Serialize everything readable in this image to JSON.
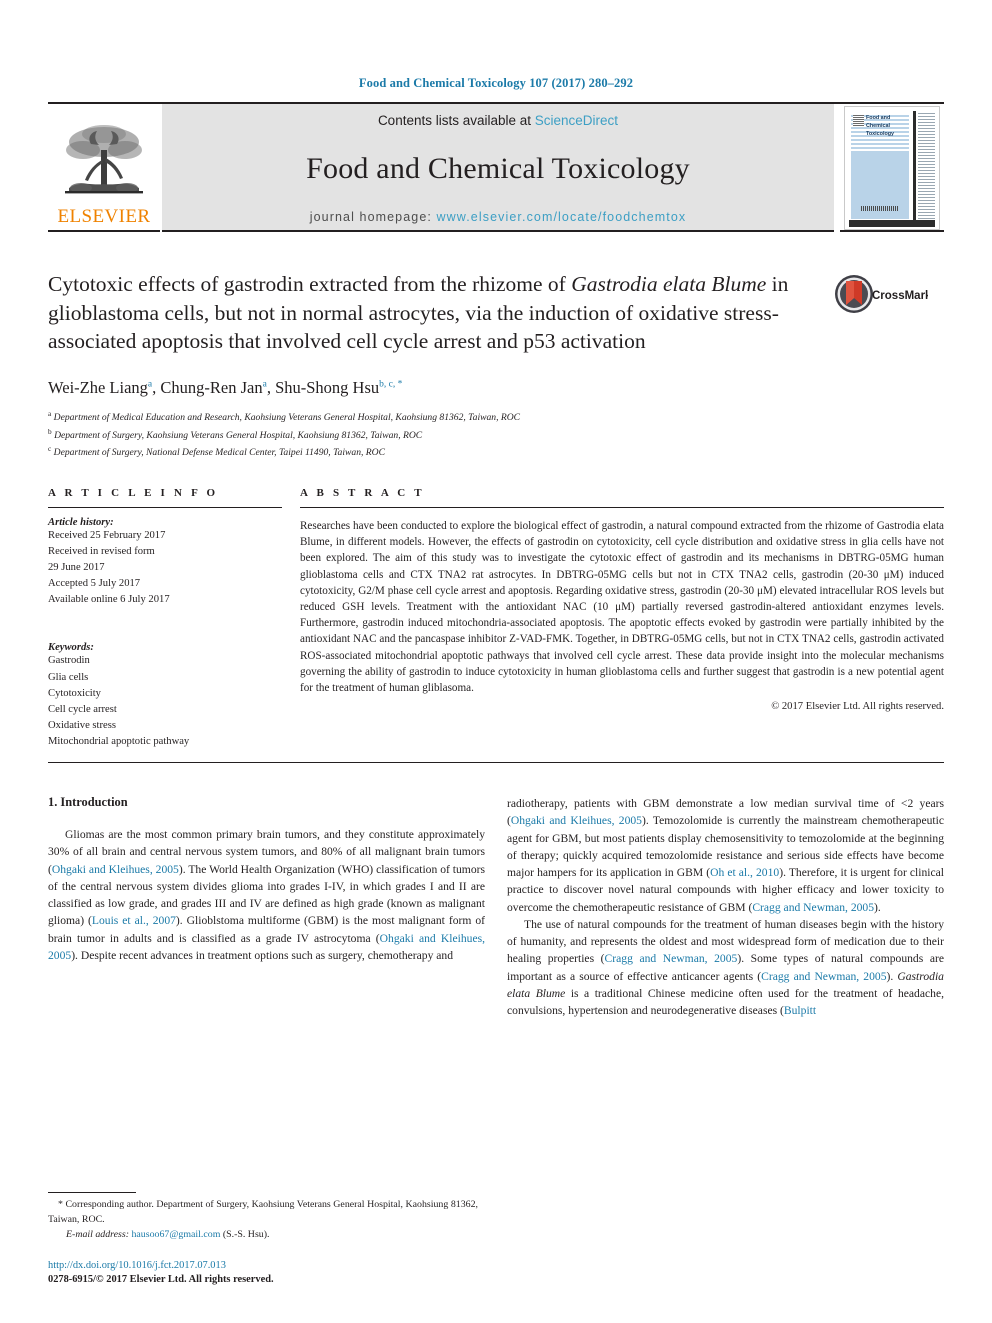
{
  "running_head": "Food and Chemical Toxicology 107 (2017) 280–292",
  "masthead": {
    "contents_prefix": "Contents lists available at ",
    "sciencedirect": "ScienceDirect",
    "journal_title": "Food and Chemical Toxicology",
    "homepage_label": "journal homepage: ",
    "homepage_url": "www.elsevier.com/locate/foodchemtox",
    "publisher": "ELSEVIER",
    "cover_title": "Food and Chemical Toxicology",
    "accent_link": "#3d9fc4",
    "accent_orange": "#ef8200",
    "cover_blue": "#b9d3e8"
  },
  "crossmark": {
    "label": "CrossMark"
  },
  "title": {
    "part1": "Cytotoxic effects of gastrodin extracted from the rhizome of ",
    "italic1": "Gastrodia elata Blume",
    "part2": " in glioblastoma cells, but not in normal astrocytes, via the induction of oxidative stress-associated apoptosis that involved cell cycle arrest and p53 activation"
  },
  "authors": [
    {
      "name": "Wei-Zhe Liang",
      "marks": "a"
    },
    {
      "name": "Chung-Ren Jan",
      "marks": "a"
    },
    {
      "name": "Shu-Shong Hsu",
      "marks": "b, c, *"
    }
  ],
  "authors_line": "Wei-Zhe Liang a, Chung-Ren Jan a, Shu-Shong Hsu b, c, *",
  "affiliations": [
    {
      "mark": "a",
      "text": "Department of Medical Education and Research, Kaohsiung Veterans General Hospital, Kaohsiung 81362, Taiwan, ROC"
    },
    {
      "mark": "b",
      "text": "Department of Surgery, Kaohsiung Veterans General Hospital, Kaohsiung 81362, Taiwan, ROC"
    },
    {
      "mark": "c",
      "text": "Department of Surgery, National Defense Medical Center, Taipei 11490, Taiwan, ROC"
    }
  ],
  "article_info": {
    "heading": "A R T I C L E   I N F O",
    "history_label": "Article history:",
    "history": [
      "Received 25 February 2017",
      "Received in revised form",
      "29 June 2017",
      "Accepted 5 July 2017",
      "Available online 6 July 2017"
    ],
    "keywords_label": "Keywords:",
    "keywords": [
      "Gastrodin",
      "Glia cells",
      "Cytotoxicity",
      "Cell cycle arrest",
      "Oxidative stress",
      "Mitochondrial apoptotic pathway"
    ]
  },
  "abstract": {
    "heading": "A B S T R A C T",
    "text": "Researches have been conducted to explore the biological effect of gastrodin, a natural compound extracted from the rhizome of Gastrodia elata Blume, in different models. However, the effects of gastrodin on cytotoxicity, cell cycle distribution and oxidative stress in glia cells have not been explored. The aim of this study was to investigate the cytotoxic effect of gastrodin and its mechanisms in DBTRG-05MG human glioblastoma cells and CTX TNA2 rat astrocytes. In DBTRG-05MG cells but not in CTX TNA2 cells, gastrodin (20-30 μM) induced cytotoxicity, G2/M phase cell cycle arrest and apoptosis. Regarding oxidative stress, gastrodin (20-30 μM) elevated intracellular ROS levels but reduced GSH levels. Treatment with the antioxidant NAC (10 μM) partially reversed gastrodin-altered antioxidant enzymes levels. Furthermore, gastrodin induced mitochondria-associated apoptosis. The apoptotic effects evoked by gastrodin were partially inhibited by the antioxidant NAC and the pancaspase inhibitor Z-VAD-FMK. Together, in DBTRG-05MG cells, but not in CTX TNA2 cells, gastrodin activated ROS-associated mitochondrial apoptotic pathways that involved cell cycle arrest. These data provide insight into the molecular mechanisms governing the ability of gastrodin to induce cytotoxicity in human glioblastoma cells and further suggest that gastrodin is a new potential agent for the treatment of human gliblasoma.",
    "copyright": "© 2017 Elsevier Ltd. All rights reserved."
  },
  "introduction": {
    "heading": "1. Introduction",
    "left_paragraphs": [
      {
        "segments": [
          {
            "t": "Gliomas are the most common primary brain tumors, and they constitute approximately 30% of all brain and central nervous system tumors, and 80% of all malignant brain tumors ("
          },
          {
            "t": "Ohgaki and Kleihues, 2005",
            "cite": true
          },
          {
            "t": "). The World Health Organization (WHO) classification of tumors of the central nervous system divides glioma into grades I-IV, in which grades I and II are classified as low grade, and grades III and IV are defined as high grade (known as malignant glioma) ("
          },
          {
            "t": "Louis et al., 2007",
            "cite": true
          },
          {
            "t": "). Glioblstoma multiforme (GBM) is the most malignant form of brain tumor in adults and is classified as a grade IV astrocytoma ("
          },
          {
            "t": "Ohgaki and Kleihues, 2005",
            "cite": true
          },
          {
            "t": "). Despite recent advances in treatment options such as surgery, chemotherapy and"
          }
        ]
      }
    ],
    "right_paragraphs": [
      {
        "indent": false,
        "segments": [
          {
            "t": "radiotherapy, patients with GBM demonstrate a low median survival time of <2 years ("
          },
          {
            "t": "Ohgaki and Kleihues, 2005",
            "cite": true
          },
          {
            "t": "). Temozolomide is currently the mainstream chemotherapeutic agent for GBM, but most patients display chemosensitivity to temozolomide at the beginning of therapy; quickly acquired temozolomide resistance and serious side effects have become major hampers for its application in GBM ("
          },
          {
            "t": "Oh et al., 2010",
            "cite": true
          },
          {
            "t": "). Therefore, it is urgent for clinical practice to discover novel natural compounds with higher efficacy and lower toxicity to overcome the chemotherapeutic resistance of GBM ("
          },
          {
            "t": "Cragg and Newman, 2005",
            "cite": true
          },
          {
            "t": ")."
          }
        ]
      },
      {
        "indent": true,
        "segments": [
          {
            "t": "The use of natural compounds for the treatment of human diseases begin with the history of humanity, and represents the oldest and most widespread form of medication due to their healing properties ("
          },
          {
            "t": "Cragg and Newman, 2005",
            "cite": true
          },
          {
            "t": "). Some types of natural compounds are important as a source of effective anticancer agents ("
          },
          {
            "t": "Cragg and Newman, 2005",
            "cite": true
          },
          {
            "t": "). "
          },
          {
            "t": "Gastrodia elata Blume",
            "italic": true
          },
          {
            "t": " is a traditional Chinese medicine often used for the treatment of headache, convulsions, hypertension and neurodegenerative diseases ("
          },
          {
            "t": "Bulpitt",
            "cite": true
          }
        ]
      }
    ]
  },
  "footnote": {
    "corresponding": "* Corresponding author. Department of Surgery, Kaohsiung Veterans General Hospital, Kaohsiung 81362, Taiwan, ROC.",
    "email_label": "E-mail address:",
    "email": "hausoo67@gmail.com",
    "email_suffix": "(S.-S. Hsu).",
    "doi": "http://dx.doi.org/10.1016/j.fct.2017.07.013",
    "issn": "0278-6915/© 2017 Elsevier Ltd. All rights reserved."
  }
}
